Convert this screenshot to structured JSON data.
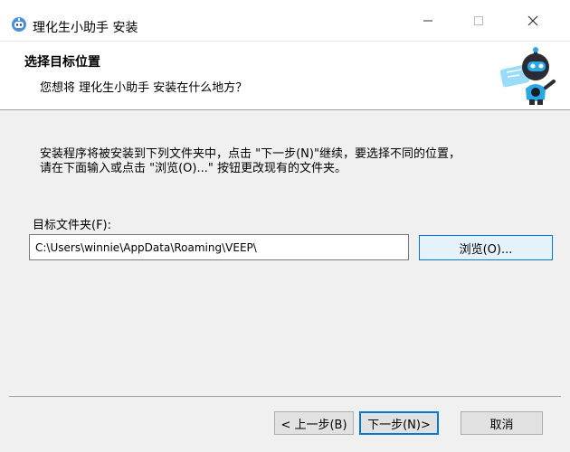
{
  "window": {
    "title": "理化生小助手 安装",
    "icons": {
      "app": "robot-app-icon",
      "minimize": "minimize-icon",
      "maximize": "maximize-icon",
      "close": "close-icon"
    }
  },
  "header": {
    "title": "选择目标位置",
    "subtitle": "您想将 理化生小助手 安装在什么地方？",
    "illustration": "robot-mascot"
  },
  "content": {
    "instruction_line1": "安装程序将被安装到下列文件夹中，点击 \"下一步(N)\"继续，要选择不同的位置，",
    "instruction_line2": "请在下面输入或点击 \"浏览(O)...\" 按钮更改现有的文件夹。",
    "folder_label": "目标文件夹(F):",
    "folder_path": "C:\\Users\\winnie\\AppData\\Roaming\\VEEP\\",
    "browse_label": "浏览(O)..."
  },
  "footer": {
    "back_label": "< 上一步(B)",
    "next_label": "下一步(N)>",
    "cancel_label": "取消"
  },
  "colors": {
    "accent": "#0078d7",
    "button_face": "#e1e1e1",
    "dialog_bg": "#f0f0f0",
    "robot_blue": "#2aa7e6"
  }
}
